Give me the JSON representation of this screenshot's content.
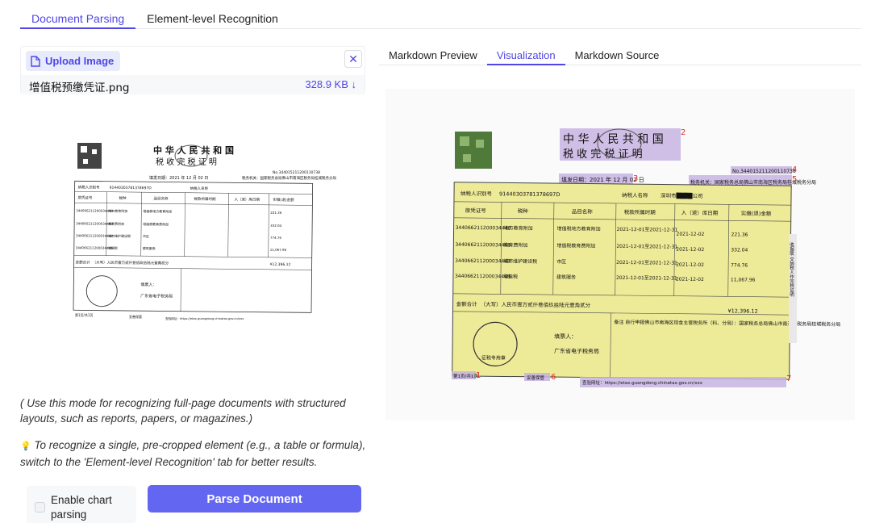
{
  "top_tabs": [
    {
      "label": "Document Parsing",
      "active": true
    },
    {
      "label": "Element-level Recognition",
      "active": false
    }
  ],
  "upload": {
    "button_label": "Upload Image",
    "close_label": "✕",
    "file_name": "增值税预缴凭证.png",
    "file_size": "328.9 KB ↓"
  },
  "right_tabs": [
    {
      "label": "Markdown Preview",
      "active": false
    },
    {
      "label": "Visualization",
      "active": true
    },
    {
      "label": "Markdown Source",
      "active": false
    }
  ],
  "notes": {
    "note1": "( Use this mode for recognizing full-page documents with structured layouts, such as reports, papers, or magazines.)",
    "note2_icon": "💡",
    "note2": "To recognize a single, pre-cropped element (e.g., a table or formula), switch to the 'Element-level Recognition' tab for better results."
  },
  "controls": {
    "chart_parsing_label": "Enable chart parsing",
    "chart_parsing_checked": false,
    "parse_button_label": "Parse Document"
  },
  "document": {
    "title_line1": "中 华 人 民 共 和 国",
    "title_line2": "税 收 完 税 证 明",
    "number": "No.344015211200110738",
    "fill_date": "填发日期：2021 年 12 月 02 日",
    "tax_authority": "税务机关：国家税务总局佛山市南海区税务局桂城税务分局",
    "taxpayer_id_label": "纳税人识别号",
    "taxpayer_id": "91440303781378697D",
    "taxpayer_name_label": "纳税人名称",
    "taxpayer_name": "深圳市████公司",
    "headers": [
      "原凭证号",
      "税种",
      "品目名称",
      "税款所属时期",
      "入（退）库日期",
      "实缴(退)金额"
    ],
    "rows": [
      {
        "cert": "344066211200034448",
        "tax": "地方教育附加",
        "item": "增值税地方教育附加",
        "period": "2021-12-01至2021-12-31",
        "date": "2021-12-02",
        "amount": "221.36"
      },
      {
        "cert": "344066211200034448",
        "tax": "教育费附加",
        "item": "增值税教育费附加",
        "period": "2021-12-01至2021-12-31",
        "date": "2021-12-02",
        "amount": "332.04"
      },
      {
        "cert": "344066211200034448",
        "tax": "城市维护建设税",
        "item": "市区",
        "period": "2021-12-01至2021-12-31",
        "date": "2021-12-02",
        "amount": "774.76"
      },
      {
        "cert": "344066211200034448",
        "tax": "增值税",
        "item": "建筑服务",
        "period": "2021-12-01至2021-12-31",
        "date": "2021-12-02",
        "amount": "11,067.96"
      }
    ],
    "total_label": "金额合计",
    "total_text": "（大写）人民币壹万贰仟叁佰玖拾陆元壹角贰分",
    "total_amount": "¥12,396.12",
    "filler_label": "填票人：",
    "filler_name": "广东省电子税务局",
    "remark": "备注  自行申报佛山市南海区现金主管税务所（科、分局）：国家税务总局佛山市南海区税务局桂城税务分局",
    "stamp_text": "征税专用章",
    "side_text": "收据联  交纳税人作完税证明",
    "footer_left": "第1页/共1页",
    "footer_mid": "妥善保管",
    "footer_right": "查验网址：https://etax.guangdong.chinatax.gov.cn/xxx",
    "box_numbers": [
      "1",
      "2",
      "3",
      "4",
      "5",
      "6",
      "7"
    ]
  },
  "colors": {
    "accent": "#4f46e5",
    "button": "#6366f1",
    "highlight_yellow": "#eeeb98",
    "highlight_purple": "#c7b3e0",
    "label_red": "#d93025"
  }
}
